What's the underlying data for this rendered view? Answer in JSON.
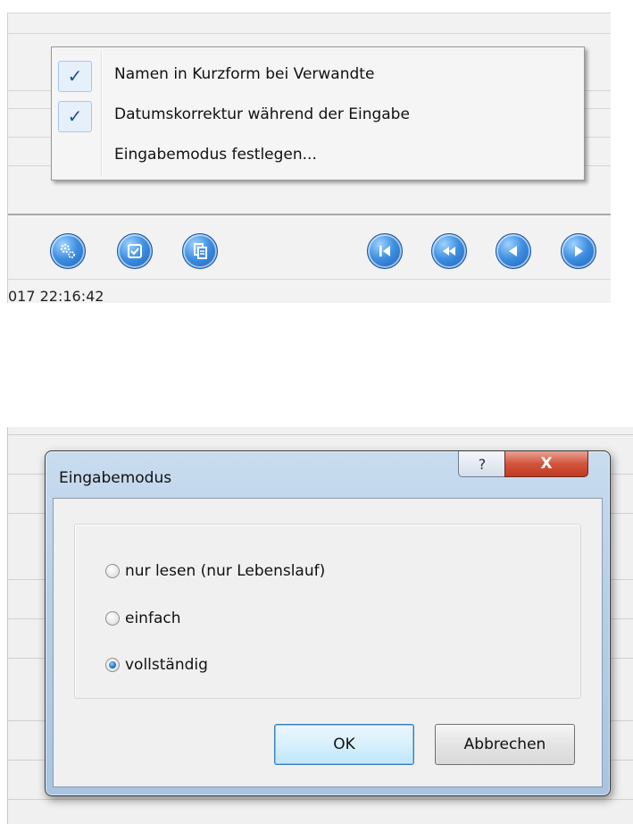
{
  "context_menu": {
    "items": [
      {
        "label": "Namen in Kurzform bei Verwandte",
        "checked": true
      },
      {
        "label": "Datumskorrektur während der Eingabe",
        "checked": true
      },
      {
        "label": "Eingabemodus festlegen...",
        "checked": false
      }
    ],
    "check_glyph": "✓"
  },
  "toolbar": {
    "icons": [
      "settings-gears-icon",
      "checkbox-check-icon",
      "copy-pages-icon",
      "first-record-icon",
      "rewind-icon",
      "previous-icon",
      "next-icon"
    ]
  },
  "status": {
    "timestamp": "017 22:16:42"
  },
  "dialog": {
    "title": "Eingabemodus",
    "help_glyph": "?",
    "close_glyph": "X",
    "options": [
      {
        "label": "nur lesen (nur Lebenslauf)",
        "selected": false
      },
      {
        "label": "einfach",
        "selected": false
      },
      {
        "label": "vollständig",
        "selected": true
      }
    ],
    "ok_label": "OK",
    "cancel_label": "Abbrechen"
  },
  "colors": {
    "accent": "#1d4e9b",
    "toolbar_icon": "#3e8fe0",
    "close_button": "#d2543c"
  }
}
